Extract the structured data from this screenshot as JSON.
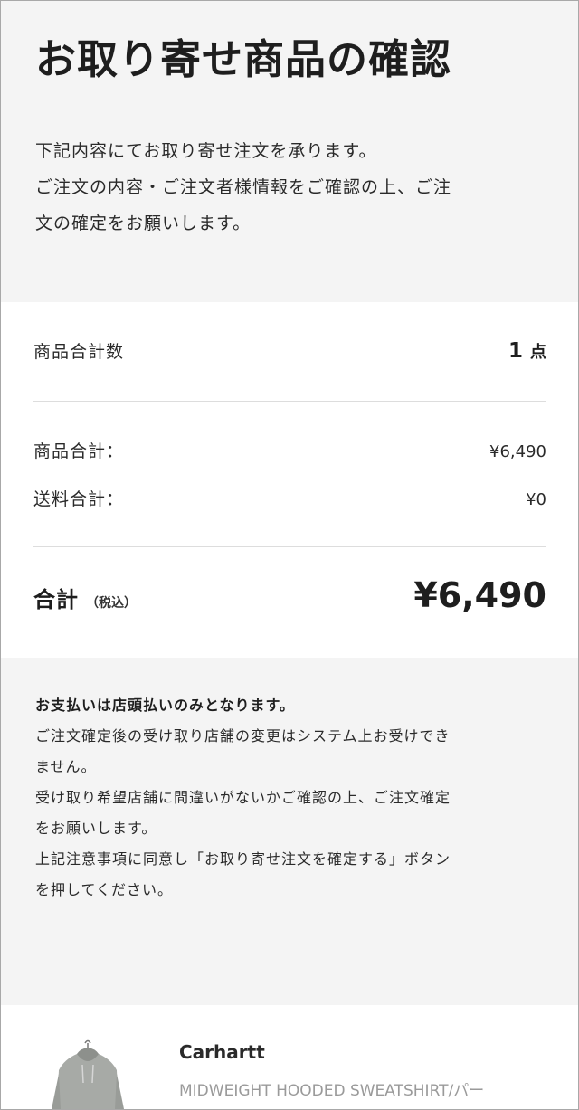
{
  "page": {
    "title": "お取り寄せ商品の確認",
    "intro_lines": [
      "下記内容にてお取り寄せ注文を承ります。",
      "ご注文の内容・ご注文者様情報をご確認の上、ご注",
      "文の確定をお願いします。"
    ]
  },
  "summary": {
    "count_label": "商品合計数",
    "count_value": "1",
    "count_unit": "点",
    "subtotal_label": "商品合計：",
    "subtotal_value": "¥6,490",
    "shipping_label": "送料合計：",
    "shipping_value": "¥0",
    "total_label": "合計",
    "total_tax_note": "（税込）",
    "total_value": "¥6,490"
  },
  "notice": {
    "heading": "お支払いは店頭払いのみとなります。",
    "lines": [
      "ご注文確定後の受け取り店舗の変更はシステム上お受けでき",
      "ません。",
      "受け取り希望店舗に間違いがないかご確認の上、ご注文確定",
      "をお願いします。",
      "上記注意事項に同意し「お取り寄せ注文を確定する」ボタン",
      "を押してください。"
    ]
  },
  "product": {
    "brand": "Carhartt",
    "name": "MIDWEIGHT HOODED SWEATSHIRT/パー",
    "image_icon": "gray-hoodie-thumbnail"
  },
  "colors": {
    "page_bg": "#f4f4f4",
    "card_bg": "#ffffff",
    "text_main": "#1e1e1e",
    "text_muted": "#9a9a9a",
    "divider": "#dddddd"
  }
}
